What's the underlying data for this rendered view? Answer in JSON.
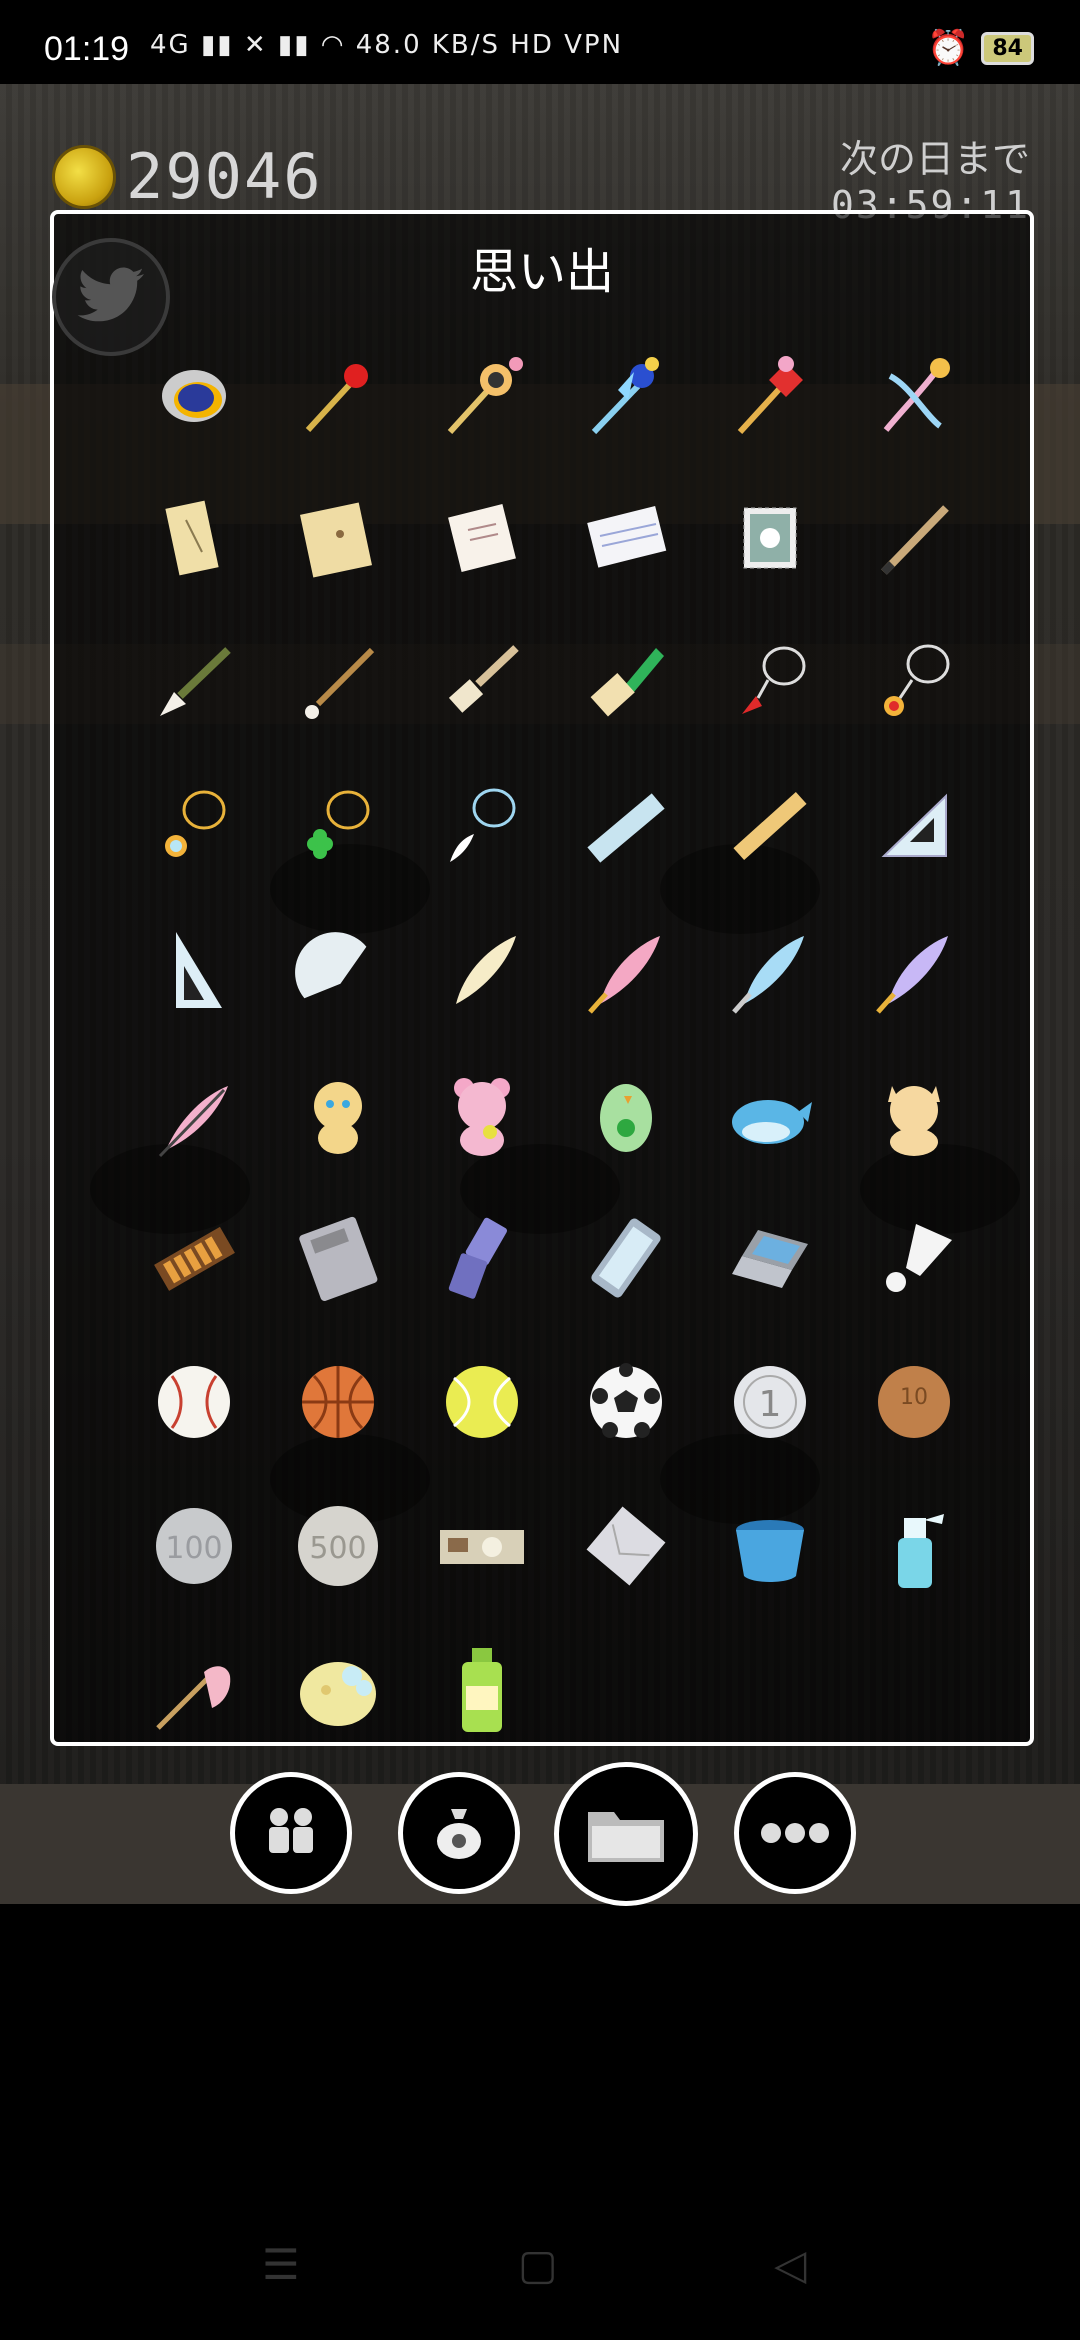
{
  "status_bar": {
    "time": "01:19",
    "indicators": "4G ▮▮ ✕ ▮▮ ◠ 48.0 KB/S HD VPN",
    "battery": "84"
  },
  "hud": {
    "coins": "29046",
    "next_day_label": "次の日まで",
    "next_day_countdown": "03:59:11"
  },
  "dialog": {
    "title": "思い出"
  },
  "items": [
    [
      "compact-mirror-icon",
      "red-scepter-icon",
      "star-wand-icon",
      "ribbon-wand-icon",
      "heart-wand-icon",
      "ribbon-staff-icon"
    ],
    [
      "scroll-icon",
      "envelope-icon",
      "letter-icon",
      "notebook-icon",
      "stamp-icon",
      "pencil-icon"
    ],
    [
      "ink-brush-icon",
      "fine-brush-icon",
      "flat-brush-icon",
      "green-brush-icon",
      "red-pendant-icon",
      "gem-pendant-icon"
    ],
    [
      "gold-pendant-icon",
      "clover-pendant-icon",
      "feather-pendant-icon",
      "ruler-icon",
      "wood-ruler-icon",
      "set-square-icon"
    ],
    [
      "triangle-ruler-icon",
      "protractor-icon",
      "cream-quill-icon",
      "pink-quill-icon",
      "blue-quill-icon",
      "purple-quill-icon"
    ],
    [
      "pink-pen-icon",
      "puppy-plush-icon",
      "bear-plush-icon",
      "parrot-plush-icon",
      "whale-plush-icon",
      "cat-plush-icon"
    ],
    [
      "abacus-icon",
      "calculator-icon",
      "flip-phone-icon",
      "smartphone-icon",
      "laptop-icon",
      "shuttlecock-icon"
    ],
    [
      "baseball-icon",
      "basketball-icon",
      "tennis-ball-icon",
      "soccer-ball-icon",
      "one-yen-coin-icon",
      "ten-yen-coin-icon"
    ],
    [
      "hundred-yen-coin-icon",
      "five-hundred-yen-coin-icon",
      "banknote-icon",
      "envelope-gray-icon",
      "bucket-icon",
      "spray-bottle-icon"
    ],
    [
      "duster-icon",
      "sponge-icon",
      "detergent-icon"
    ]
  ],
  "coin_labels": {
    "one": "1",
    "ten": "10",
    "hundred": "100",
    "five_hundred": "500"
  },
  "nav": [
    "friends-icon",
    "money-bag-icon",
    "folder-icon",
    "more-icon"
  ]
}
